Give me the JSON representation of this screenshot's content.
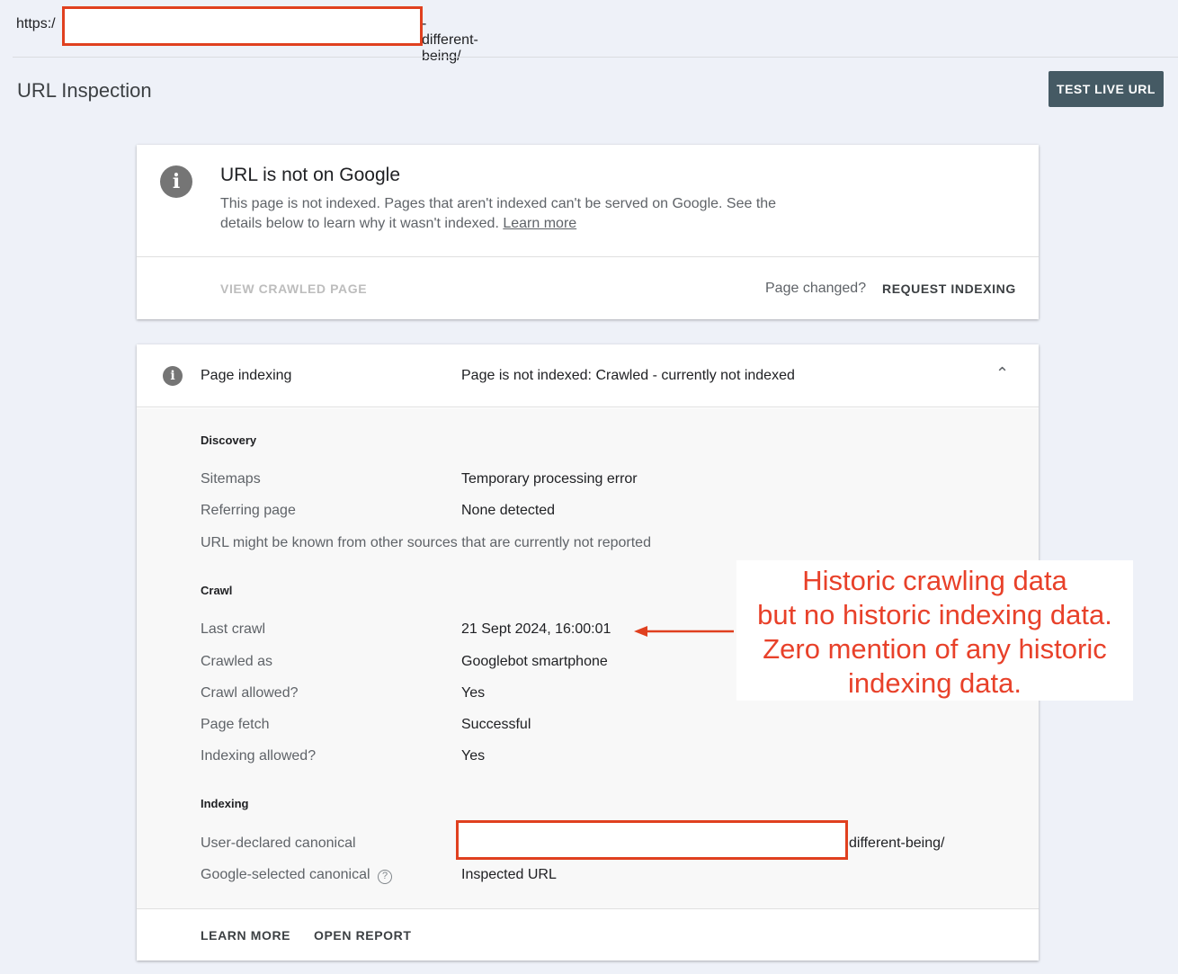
{
  "url_bar": {
    "prefix": "https:/",
    "suffix": "-different-being/"
  },
  "header": {
    "title": "URL Inspection",
    "test_live_url": "TEST LIVE URL"
  },
  "status_card": {
    "title": "URL is not on Google",
    "desc": "This page is not indexed. Pages that aren't indexed can't be served on Google. See the details below to learn why it wasn't indexed.",
    "learn_more": "Learn more",
    "view_crawled": "VIEW CRAWLED PAGE",
    "page_changed": "Page changed?",
    "request_indexing": "REQUEST INDEXING"
  },
  "indexing_card": {
    "label": "Page indexing",
    "status": "Page is not indexed: Crawled - currently not indexed",
    "discovery": {
      "heading": "Discovery",
      "sitemaps_label": "Sitemaps",
      "sitemaps_value": "Temporary processing error",
      "referring_label": "Referring page",
      "referring_value": "None detected",
      "note": "URL might be known from other sources that are currently not reported"
    },
    "crawl": {
      "heading": "Crawl",
      "rows": [
        {
          "label": "Last crawl",
          "value": "21 Sept 2024, 16:00:01"
        },
        {
          "label": "Crawled as",
          "value": "Googlebot smartphone"
        },
        {
          "label": "Crawl allowed?",
          "value": "Yes"
        },
        {
          "label": "Page fetch",
          "value": "Successful"
        },
        {
          "label": "Indexing allowed?",
          "value": "Yes"
        }
      ]
    },
    "indexing": {
      "heading": "Indexing",
      "user_canonical_label": "User-declared canonical",
      "user_canonical_suffix": "different-being/",
      "google_canonical_label": "Google-selected canonical",
      "google_canonical_value": "Inspected URL"
    },
    "learn_more": "LEARN MORE",
    "open_report": "OPEN REPORT"
  },
  "annotation": {
    "line1": "Historic crawling data",
    "line2": "but no historic indexing data.",
    "line3": "Zero mention of any historic",
    "line4": "indexing data."
  }
}
